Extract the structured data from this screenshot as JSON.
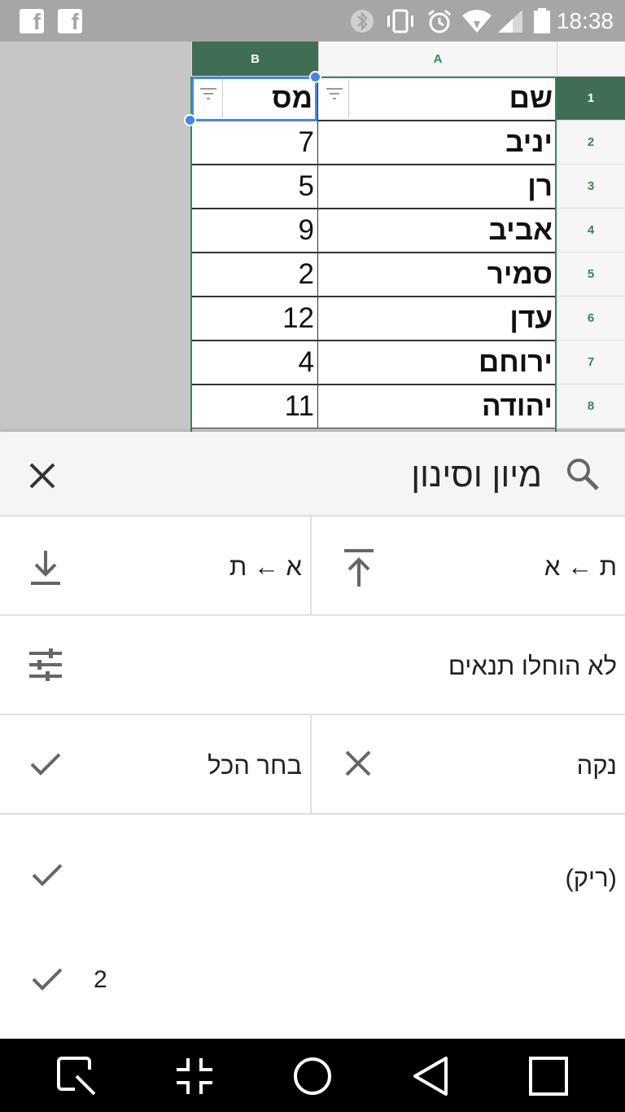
{
  "status_bar": {
    "time": "18:38",
    "icons": [
      "facebook-icon",
      "facebook-icon",
      "bluetooth-icon",
      "vibrate-icon",
      "alarm-icon",
      "wifi-icon",
      "signal-icon",
      "battery-icon"
    ]
  },
  "sheet": {
    "columns": [
      {
        "label": "B",
        "selected": true
      },
      {
        "label": "A",
        "selected": false
      }
    ],
    "rows": [
      {
        "num": "1",
        "a": "שם",
        "b": "מס"
      },
      {
        "num": "2",
        "a": "יניב",
        "b": "7"
      },
      {
        "num": "3",
        "a": "רן",
        "b": "5"
      },
      {
        "num": "4",
        "a": "אביב",
        "b": "9"
      },
      {
        "num": "5",
        "a": "סמיר",
        "b": "2"
      },
      {
        "num": "6",
        "a": "עדן",
        "b": "12"
      },
      {
        "num": "7",
        "a": "ירוחם",
        "b": "4"
      },
      {
        "num": "8",
        "a": "יהודה",
        "b": "11"
      }
    ],
    "colors": {
      "accent": "#3f6e55",
      "selection": "#4285f4",
      "green_text": "#2e8b57"
    }
  },
  "panel": {
    "title": "מיון וסינון",
    "sort_az": "ת ← א",
    "sort_za": "א ← ת",
    "conditions": "לא הוחלו תנאים",
    "clear": "נקה",
    "select_all": "בחר הכל",
    "values": [
      {
        "label": "(ריק)",
        "checked": true
      },
      {
        "label": "2",
        "checked": true
      }
    ]
  },
  "nav_bar": {
    "buttons": [
      "screenshot-edit-icon",
      "exit-fullscreen-icon",
      "home-icon",
      "back-icon",
      "recents-icon"
    ]
  }
}
